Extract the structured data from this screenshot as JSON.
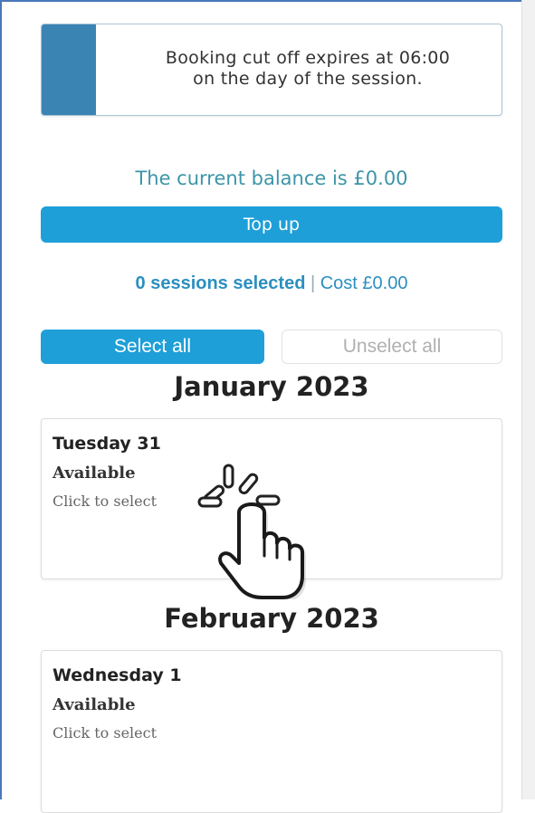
{
  "notice": {
    "line1": "Booking cut off expires at 06:00",
    "line2": "on the day of the session."
  },
  "balance": {
    "text": "The current balance is £0.00"
  },
  "topup": {
    "label": "Top up"
  },
  "summary": {
    "sessions": "0 sessions selected",
    "separator": "|",
    "cost": "Cost £0.00"
  },
  "controls": {
    "select_all": "Select all",
    "unselect_all": "Unselect all"
  },
  "months": [
    {
      "title": "January 2023",
      "sessions": [
        {
          "day": "Tuesday 31",
          "status": "Available",
          "hint": "Click to select"
        }
      ]
    },
    {
      "title": "February 2023",
      "sessions": [
        {
          "day": "Wednesday 1",
          "status": "Available",
          "hint": "Click to select"
        }
      ]
    }
  ],
  "colors": {
    "accent": "#1e9fd8",
    "notice_bar": "#3a84b4",
    "balance_text": "#3c95a8"
  },
  "icons": {
    "cursor": "hand-pointer-click-icon"
  }
}
